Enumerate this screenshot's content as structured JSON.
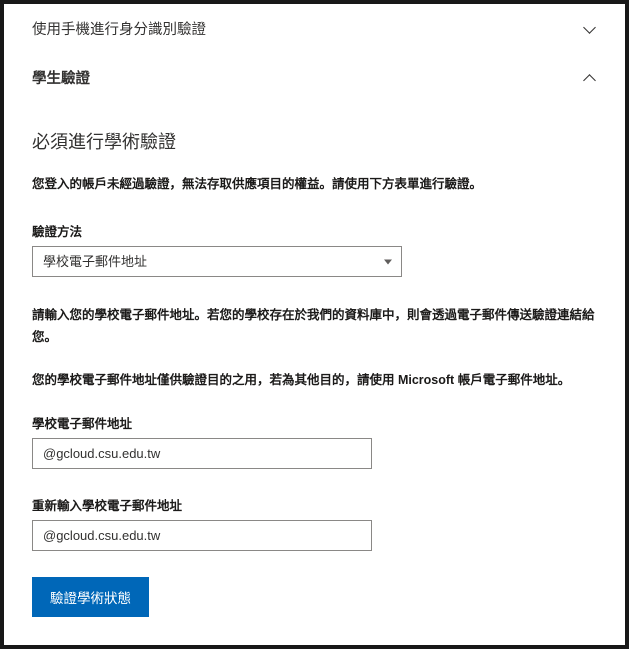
{
  "accordion1": {
    "title": "使用手機進行身分識別驗證"
  },
  "accordion2": {
    "title": "學生驗證"
  },
  "section": {
    "heading": "必須進行學術驗證",
    "intro": "您登入的帳戶未經過驗證，無法存取供應項目的權益。請使用下方表單進行驗證。"
  },
  "method": {
    "label": "驗證方法",
    "selected": "學校電子郵件地址"
  },
  "helper1": "請輸入您的學校電子郵件地址。若您的學校存在於我們的資料庫中，則會透過電子郵件傳送驗證連結給您。",
  "helper2": "您的學校電子郵件地址僅供驗證目的之用，若為其他目的，請使用 Microsoft 帳戶電子郵件地址。",
  "emailField": {
    "label": "學校電子郵件地址",
    "value": "@gcloud.csu.edu.tw"
  },
  "confirmField": {
    "label": "重新輸入學校電子郵件地址",
    "value": "@gcloud.csu.edu.tw"
  },
  "submit": {
    "label": "驗證學術狀態"
  }
}
